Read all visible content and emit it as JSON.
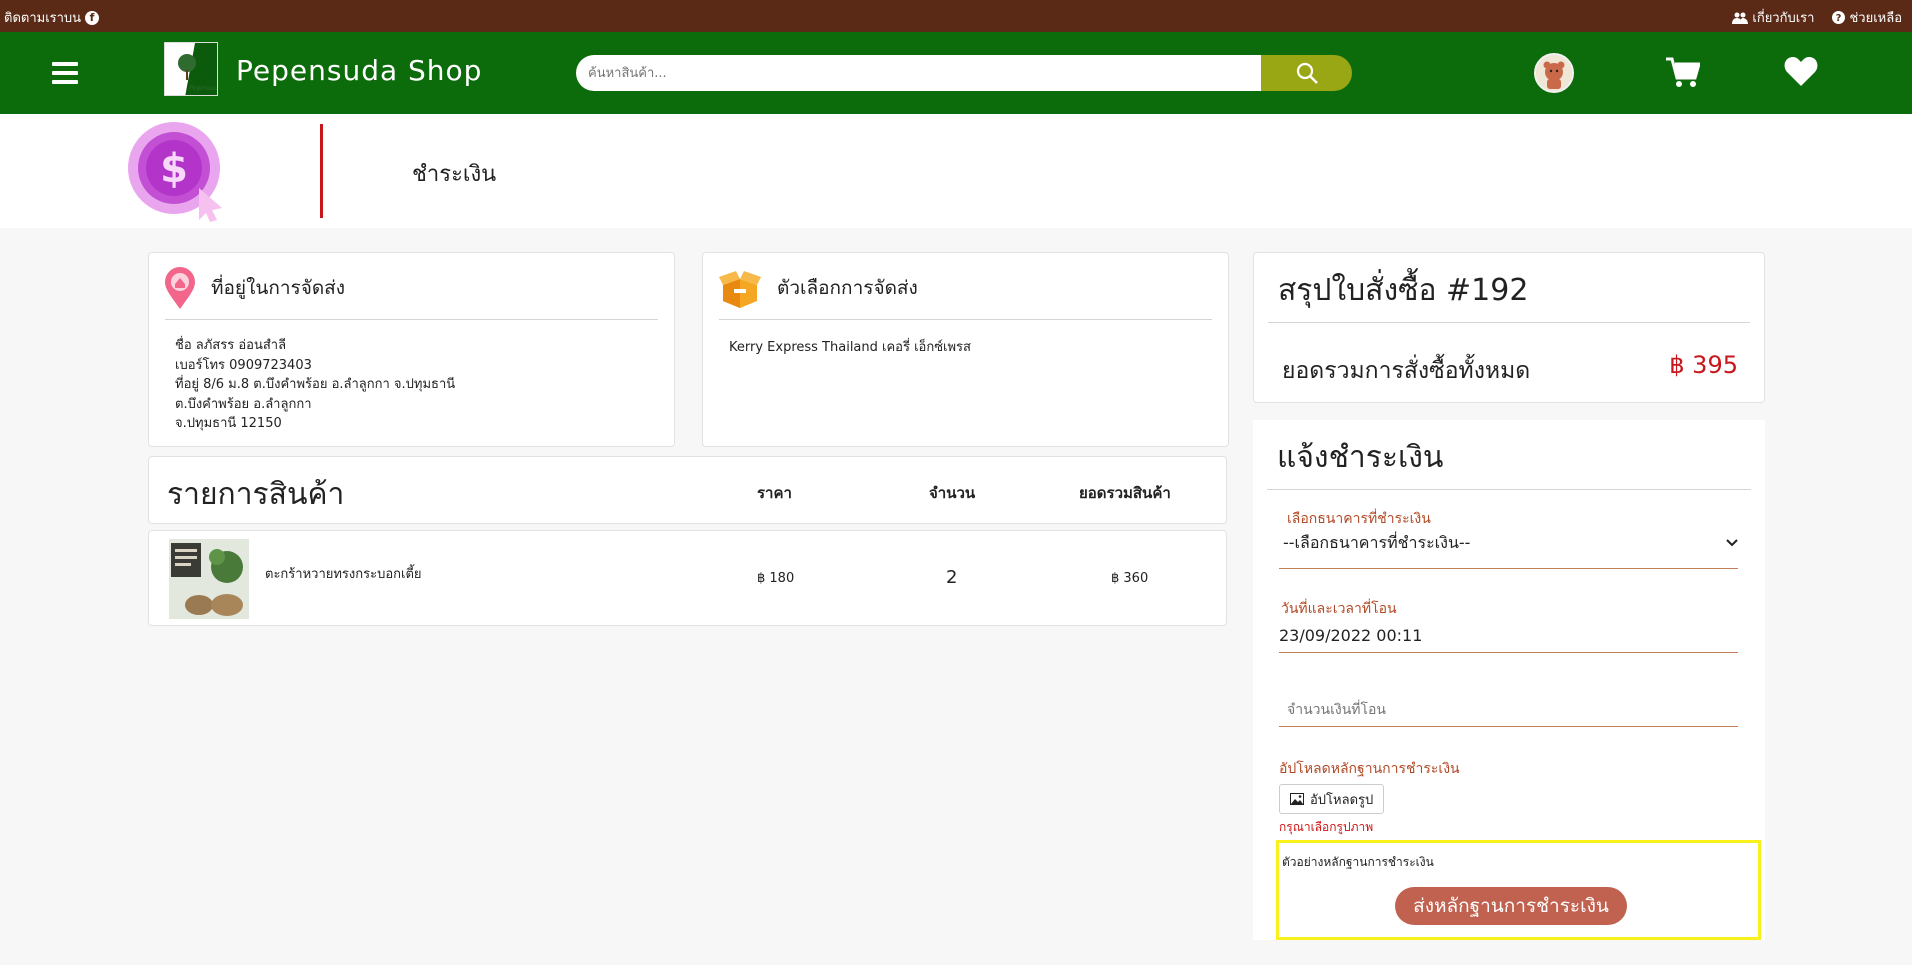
{
  "topbar": {
    "follow_label": "ติดตามเราบน",
    "about_label": "เกี่ยวกับเรา",
    "help_label": "ช่วยเหลือ"
  },
  "header": {
    "brand": "Pepensuda Shop",
    "search_placeholder": "ค้นหาสินค้า..."
  },
  "banner": {
    "title": "ชำระเงิน"
  },
  "address": {
    "title": "ที่อยู่ในการจัดส่ง",
    "lines": [
      "ชื่อ ลภัสรร อ่อนสำลี",
      "เบอร์โทร 0909723403",
      "ที่อยู่ 8/6 ม.8 ต.บึงคำพร้อย อ.ลำลูกกา จ.ปทุมธานี",
      "ต.บึงคำพร้อย อ.ลำลูกกา",
      "จ.ปทุมธานี 12150"
    ]
  },
  "shipping": {
    "title": "ตัวเลือกการจัดส่ง",
    "option": "Kerry Express Thailand เคอรี่ เอ็กซ์เพรส"
  },
  "items": {
    "title": "รายการสินค้า",
    "col_price": "ราคา",
    "col_qty": "จำนวน",
    "col_total": "ยอดรวมสินค้า",
    "rows": [
      {
        "name": "ตะกร้าหวายทรงกระบอกเตี้ย",
        "price": "฿ 180",
        "qty": "2",
        "total": "฿ 360"
      }
    ]
  },
  "summary": {
    "title": "สรุปใบสั่งซื้อ #192",
    "total_label": "ยอดรวมการสั่งซื้อทั้งหมด",
    "total_amount": "฿ 395"
  },
  "payment": {
    "title": "แจ้งชำระเงิน",
    "bank_label": "เลือกธนาคารที่ชำระเงิน",
    "bank_selected": "--เลือกธนาคารที่ชำระเงิน--",
    "datetime_label": "วันที่และเวลาที่โอน",
    "datetime_value": "23/09/2022 00:11",
    "amount_placeholder": "จำนวนเงินที่โอน",
    "upload_label": "อัปโหลดหลักฐานการชำระเงิน",
    "upload_button": "อัปโหลดรูป",
    "upload_error": "กรุณาเลือกรูปภาพ",
    "example_label": "ตัวอย่างหลักฐานการชำระเงิน",
    "submit_button": "ส่งหลักฐานการชำระเงิน"
  },
  "colors": {
    "topbar": "#5a2a17",
    "header": "#0c6b0a",
    "search_button": "#9aa714",
    "accent_red": "#c8161d",
    "submit": "#c0624f",
    "highlight": "#fbf11a"
  }
}
